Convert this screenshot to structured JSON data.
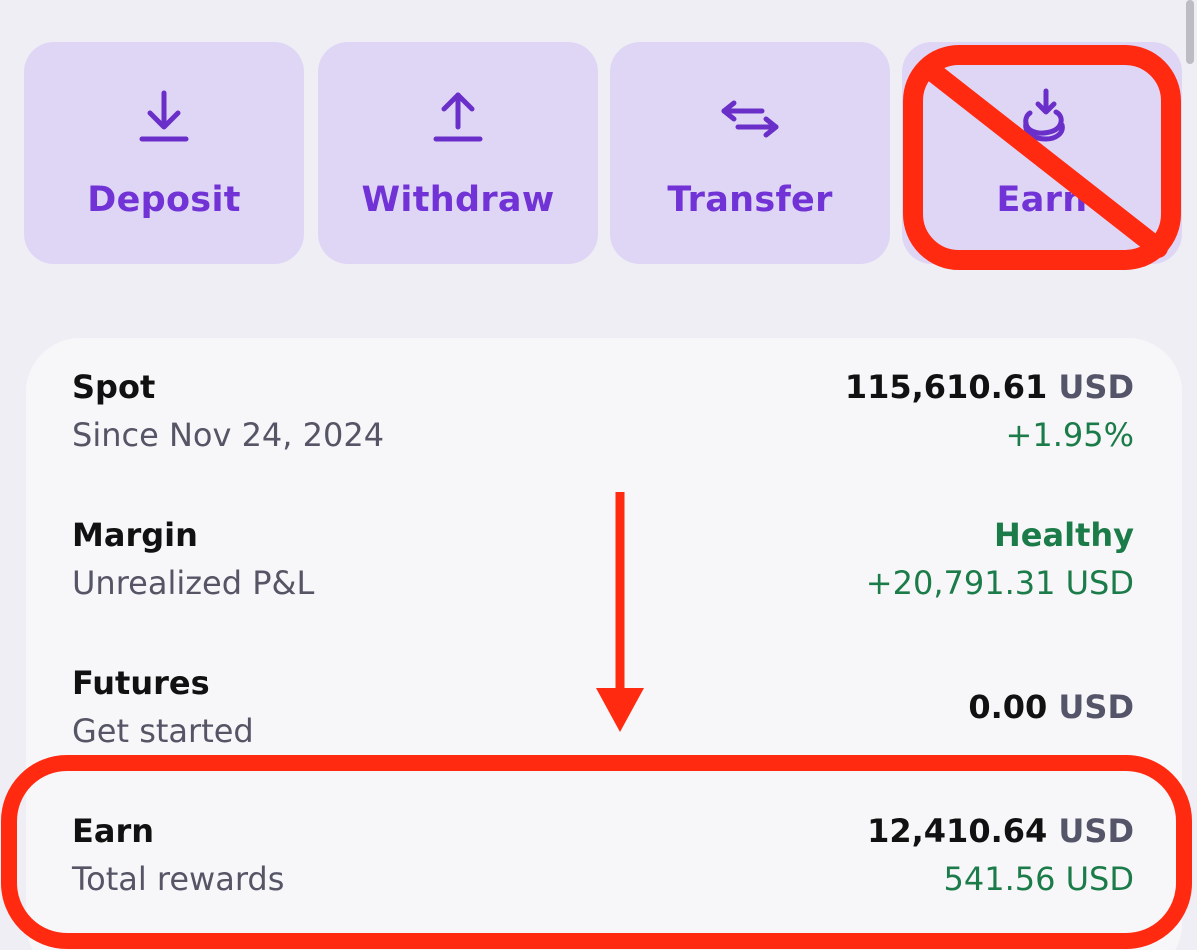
{
  "actions": [
    {
      "label": "Deposit",
      "icon": "deposit-arrow-down-icon"
    },
    {
      "label": "Withdraw",
      "icon": "withdraw-arrow-up-icon"
    },
    {
      "label": "Transfer",
      "icon": "transfer-arrows-icon"
    },
    {
      "label": "Earn",
      "icon": "earn-coins-icon"
    }
  ],
  "accounts": {
    "spot": {
      "name": "Spot",
      "sub": "Since Nov 24, 2024",
      "amount": "115,610.61",
      "unit": "USD",
      "change": "+1.95%"
    },
    "margin": {
      "name": "Margin",
      "sub": "Unrealized P&L",
      "status": "Healthy",
      "pnl": "+20,791.31 USD"
    },
    "futures": {
      "name": "Futures",
      "sub": "Get started",
      "amount": "0.00",
      "unit": "USD"
    },
    "earn": {
      "name": "Earn",
      "sub": "Total rewards",
      "amount": "12,410.64",
      "unit": "USD",
      "rewards": "541.56 USD"
    }
  },
  "colors": {
    "tile_bg": "#dfd6f6",
    "accent": "#7132d6",
    "positive": "#1c7c49",
    "annotation": "#ff2a10"
  }
}
